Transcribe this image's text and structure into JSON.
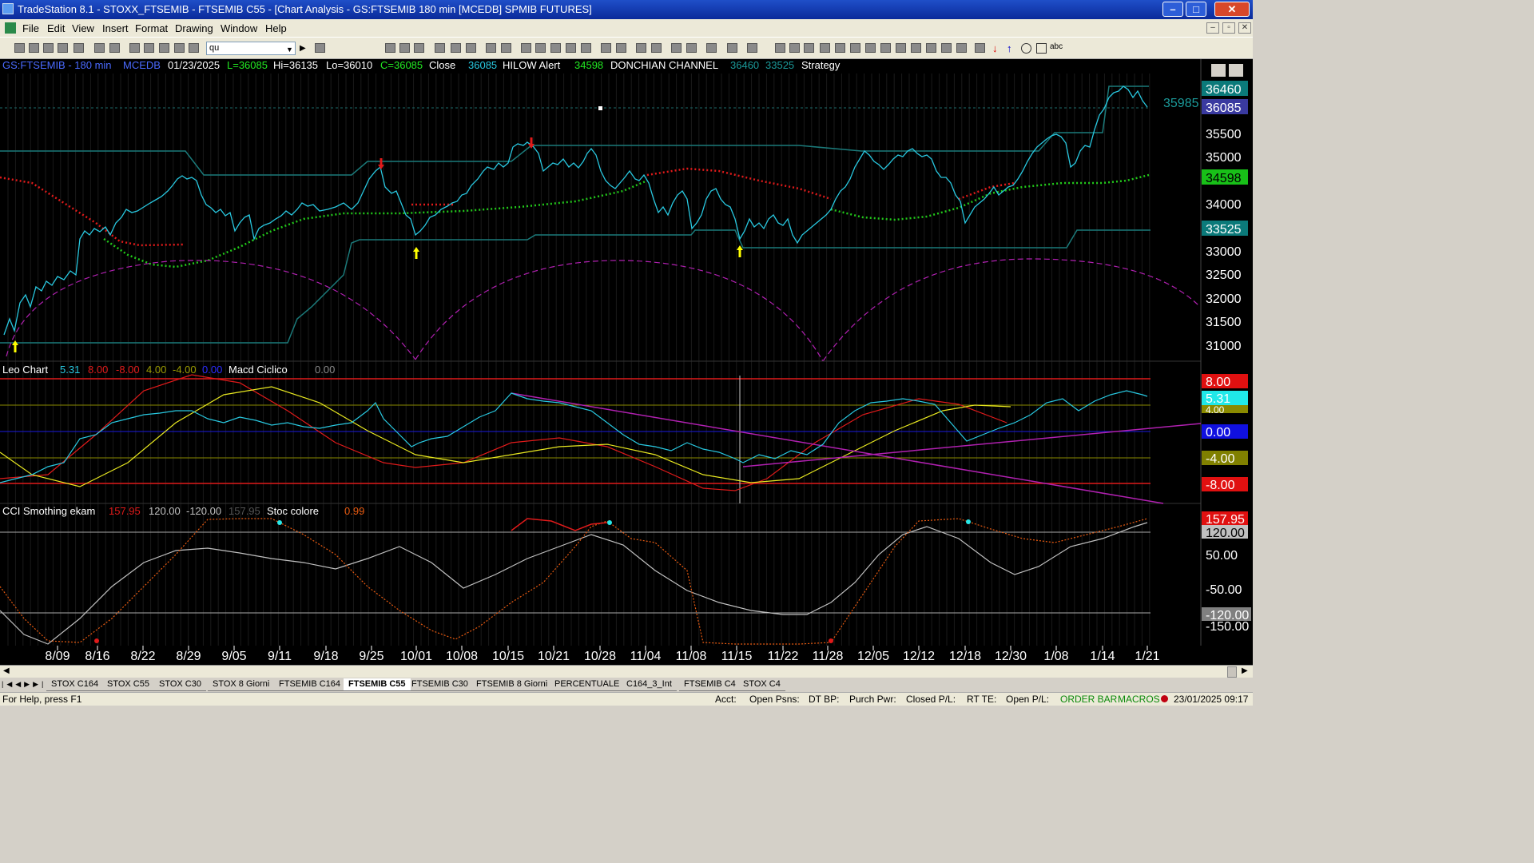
{
  "window": {
    "title": "TradeStation 8.1 - STOXX_FTSEMIB - FTSEMIB C55 - [Chart Analysis - GS:FTSEMIB  180 min  [MCEDB] SPMIB FUTURES]",
    "minimize": "–",
    "maximize": "□",
    "close": "✕"
  },
  "menu": [
    "File",
    "Edit",
    "View",
    "Insert",
    "Format",
    "Drawing",
    "Window",
    "Help"
  ],
  "toolbar": {
    "symbol_value": "qu"
  },
  "header": {
    "symbol": "GS:FTSEMIB - 180 min",
    "feed": "MCEDB",
    "date": "01/23/2025",
    "low": "L=36085",
    "high": "Hi=36135",
    "lo": "Lo=36010",
    "close": "C=36085",
    "close_label": "Close",
    "close_val": "36085",
    "hilow_label": "HILOW Alert",
    "hilow_val": "34598",
    "don_label": "DONCHIAN CHANNEL",
    "don_up": "36460",
    "don_dn": "33525",
    "strategy": "Strategy"
  },
  "price_axis": {
    "ticks": [
      "35500",
      "35000",
      "34500",
      "34000",
      "33500",
      "33000",
      "32500",
      "32000",
      "31500",
      "31000"
    ],
    "badges": [
      {
        "text": "36460",
        "bg": "#0b7a7a"
      },
      {
        "text": "36085",
        "bg": "#3a3aa0"
      },
      {
        "text": "34598",
        "bg": "#18c018"
      },
      {
        "text": "33525",
        "bg": "#0b7a7a"
      }
    ],
    "last_label": "35985"
  },
  "panel2": {
    "labels": [
      "Leo Chart",
      "5.31",
      "8.00",
      "-8.00",
      "4.00",
      "-4.00",
      "0.00",
      "Macd Ciclico",
      "0.00"
    ],
    "badges": [
      {
        "text": "8.00",
        "bg": "#e01010"
      },
      {
        "text": "5.31",
        "bg": "#20e8e8"
      },
      {
        "text": "4.00",
        "bg": "#8a8a00"
      },
      {
        "text": "0.00",
        "bg": "#1010e0"
      },
      {
        "text": "-4.00",
        "bg": "#808000"
      },
      {
        "text": "-8.00",
        "bg": "#e01010"
      }
    ]
  },
  "panel3": {
    "labels": [
      "CCI Smothing ekam",
      "157.95",
      "120.00",
      "-120.00",
      "157.95",
      "Stoc colore",
      "0.99"
    ],
    "ticks": [
      "50.00",
      "-50.00",
      "-150.00"
    ],
    "badges": [
      {
        "text": "157.95",
        "bg": "#e01010"
      },
      {
        "text": "120.00",
        "bg": "#c0c0c0"
      },
      {
        "text": "-120.00",
        "bg": "#808080"
      }
    ]
  },
  "x_axis": [
    "8/09",
    "8/16",
    "8/22",
    "8/29",
    "9/05",
    "9/11",
    "9/18",
    "9/25",
    "10/01",
    "10/08",
    "10/15",
    "10/21",
    "10/28",
    "11/04",
    "11/08",
    "11/15",
    "11/22",
    "11/28",
    "12/05",
    "12/12",
    "12/18",
    "12/30",
    "1/08",
    "1/14",
    "1/21"
  ],
  "tabs": [
    "STOX C164",
    "STOX C55",
    "STOX  C30",
    "STOX  8 Giorni",
    "FTSEMIB C164",
    "FTSEMIB C55",
    "FTSEMIB C30",
    "FTSEMIB  8 Giorni",
    "PERCENTUALE",
    "C164_3_Int",
    "FTSEMIB C4",
    "STOX  C4"
  ],
  "active_tab": "FTSEMIB C55",
  "status": {
    "help": "For Help, press F1",
    "acct": "Acct:",
    "open_psns": "Open Psns:",
    "dtbp": "DT BP:",
    "purch": "Purch Pwr:",
    "closed_pl": "Closed P/L:",
    "rtte": "RT TE:",
    "open_pl": "Open P/L:",
    "orderbar": "ORDER BAR",
    "macros": "MACROS",
    "datetime": "23/01/2025 09:17"
  },
  "chart_data": {
    "type": "line",
    "title": "GS:FTSEMIB - 180 min",
    "x": [
      "8/09",
      "8/16",
      "8/22",
      "8/29",
      "9/05",
      "9/11",
      "9/18",
      "9/25",
      "10/01",
      "10/08",
      "10/15",
      "10/21",
      "10/28",
      "11/04",
      "11/08",
      "11/15",
      "11/22",
      "11/28",
      "12/05",
      "12/12",
      "12/18",
      "12/30",
      "1/08",
      "1/14",
      "1/21"
    ],
    "series": [
      {
        "name": "Close",
        "values": [
          31200,
          33400,
          34000,
          34450,
          33700,
          33500,
          34000,
          34100,
          33300,
          33800,
          34900,
          34800,
          34500,
          34200,
          33300,
          33200,
          33300,
          33600,
          34900,
          35000,
          33700,
          34500,
          35000,
          36300,
          36085
        ]
      },
      {
        "name": "HILOW Alert",
        "values": [
          31800,
          33200,
          32700,
          32800,
          33300,
          33700,
          33900,
          33800,
          33800,
          33900,
          34000,
          34150,
          34300,
          34600,
          34800,
          34700,
          34400,
          33900,
          33700,
          33700,
          34000,
          34300,
          34400,
          34450,
          34598
        ]
      },
      {
        "name": "DONCHIAN CHANNEL",
        "values": [
          36460,
          33525
        ]
      }
    ],
    "ylim": [
      30800,
      36700
    ],
    "indicators": [
      {
        "name": "Leo Chart",
        "value": 5.31,
        "levels": [
          8.0,
          -8.0,
          4.0,
          -4.0,
          0.0
        ]
      },
      {
        "name": "Macd Ciclico",
        "value": 0.0
      },
      {
        "name": "CCI Smothing ekam",
        "value": 157.95,
        "levels": [
          120.0,
          -120.0
        ]
      },
      {
        "name": "Stoc colore",
        "value": 0.99
      }
    ]
  }
}
